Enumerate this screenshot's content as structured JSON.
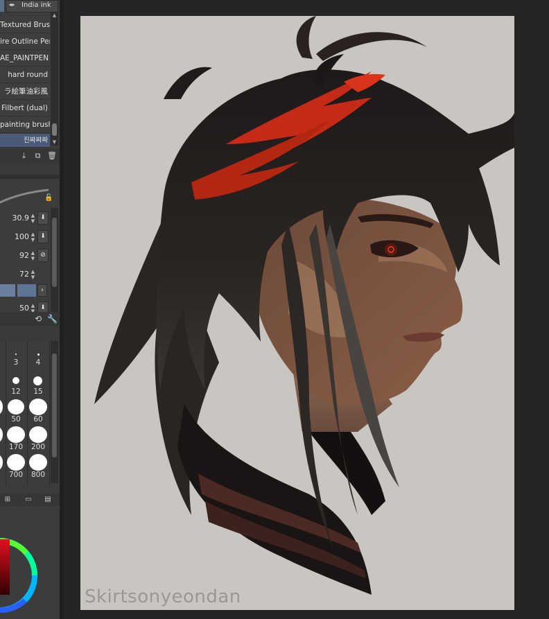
{
  "brush_list": {
    "top_tab_label": "India ink",
    "items": [
      {
        "label": "Textured Brush"
      },
      {
        "label": "ire Outline Pen"
      },
      {
        "label": "AE_PAINTPEN"
      },
      {
        "label": "hard round"
      },
      {
        "label": "ラ絵筆油彩風"
      },
      {
        "label": "Filbert (dual)"
      },
      {
        "label": "painting brush"
      },
      {
        "label": "진짜짜짜"
      }
    ],
    "selected_index": 7
  },
  "tool_property": {
    "rows": [
      {
        "value": "30.9",
        "button": "⬇"
      },
      {
        "value": "100",
        "button": "⬇"
      },
      {
        "value": "92",
        "button": "⊘"
      },
      {
        "value": "72",
        "button": ""
      },
      {
        "value": "50",
        "button": "⬇"
      }
    ]
  },
  "brush_size": {
    "cells": [
      {
        "label": "3"
      },
      {
        "label": "4"
      },
      {
        "label": "12"
      },
      {
        "label": "15"
      },
      {
        "label": "50"
      },
      {
        "label": "60"
      },
      {
        "label": "170"
      },
      {
        "label": "200"
      },
      {
        "label": "700"
      },
      {
        "label": "800"
      }
    ]
  },
  "canvas": {
    "signature": "Skirtsonyeondan"
  },
  "colors": {
    "panel_bg": "#3c3c3c",
    "selection": "#4a5a78",
    "paper": "#c9c6c1",
    "hair_red": "#c42a16",
    "hair_dark": "#231d1b",
    "skin": "#8a5a40"
  }
}
